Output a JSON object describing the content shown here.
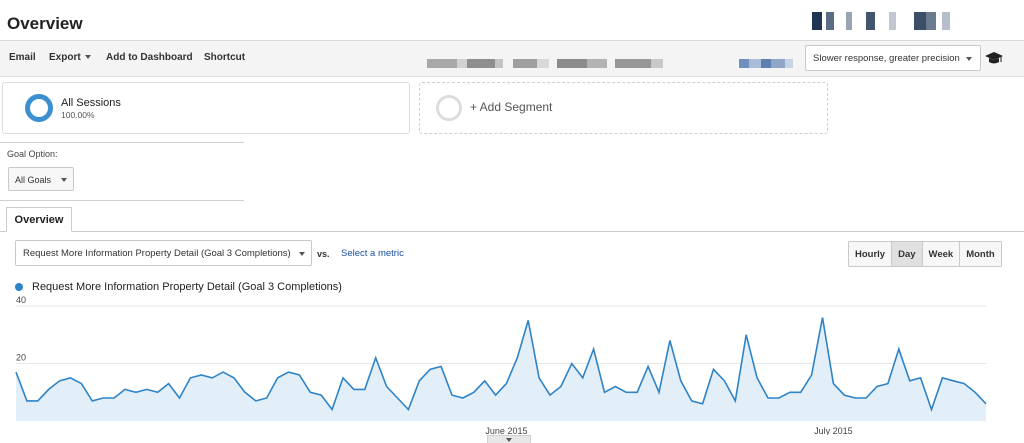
{
  "header": {
    "title": "Overview"
  },
  "toolbar": {
    "email": "Email",
    "export": "Export",
    "add_to_dashboard": "Add to Dashboard",
    "shortcut": "Shortcut",
    "sampling": "Slower response, greater precision"
  },
  "segments": {
    "primary_name": "All Sessions",
    "primary_pct": "100.00%",
    "add_label": "+ Add Segment"
  },
  "goal": {
    "label": "Goal Option:",
    "selected": "All Goals"
  },
  "tabs": [
    {
      "label": "Overview"
    }
  ],
  "metric": {
    "selected": "Request More Information Property Detail (Goal 3 Completions)",
    "vs": "vs.",
    "select_metric": "Select a metric"
  },
  "periods": [
    "Hourly",
    "Day",
    "Week",
    "Month"
  ],
  "active_period": "Day",
  "colors": {
    "series": "#2f83c7",
    "fill": "#e3eff8",
    "accent": "#3c8fd0"
  },
  "chart_data": {
    "type": "area",
    "series": [
      {
        "name": "Request More Information Property Detail (Goal 3 Completions)",
        "values": [
          17,
          7,
          7,
          11,
          14,
          15,
          13,
          7,
          8,
          8,
          11,
          10,
          11,
          10,
          13,
          8,
          15,
          16,
          15,
          17,
          15,
          10,
          7,
          8,
          15,
          17,
          16,
          10,
          9,
          4,
          15,
          11,
          11,
          22,
          12,
          8,
          4,
          14,
          18,
          19,
          9,
          8,
          10,
          14,
          9,
          13,
          22,
          35,
          15,
          9,
          12,
          20,
          15,
          25,
          10,
          12,
          10,
          10,
          19,
          10,
          28,
          14,
          7,
          6,
          18,
          14,
          7,
          30,
          15,
          8,
          8,
          10,
          10,
          16,
          36,
          13,
          9,
          8,
          8,
          12,
          13,
          25,
          14,
          15,
          4,
          15,
          14,
          13,
          10,
          6
        ],
        "show_in_legend": true
      }
    ],
    "y_ticks": [
      20,
      40
    ],
    "ylim": [
      0,
      40
    ],
    "x_labels": [
      {
        "label": "June 2015",
        "index": 45
      },
      {
        "label": "July 2015",
        "index": 75
      }
    ],
    "grid": true
  }
}
